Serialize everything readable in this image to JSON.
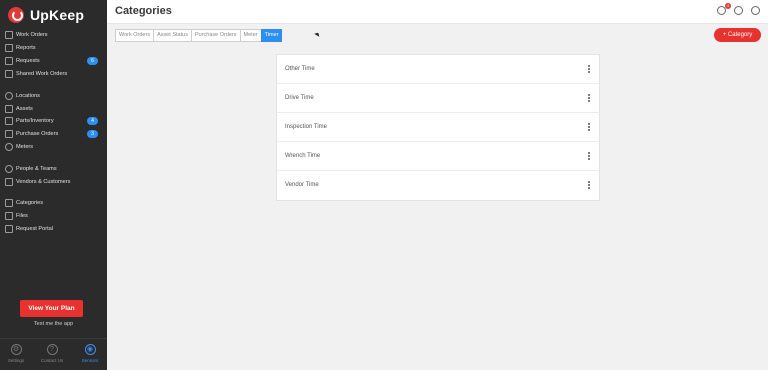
{
  "brand": {
    "name": "UpKeep"
  },
  "sidebar": {
    "items": [
      {
        "label": "Work Orders",
        "icon": "clipboard-icon"
      },
      {
        "label": "Reports",
        "icon": "report-icon"
      },
      {
        "label": "Requests",
        "icon": "inbox-icon",
        "badge": "6"
      },
      {
        "label": "Shared Work Orders",
        "icon": "share-icon"
      },
      {
        "label": "Locations",
        "icon": "location-icon"
      },
      {
        "label": "Assets",
        "icon": "asset-icon"
      },
      {
        "label": "Parts/Inventory",
        "icon": "wrench-icon",
        "badge": "4"
      },
      {
        "label": "Purchase Orders",
        "icon": "cart-icon",
        "badge": "3"
      },
      {
        "label": "Meters",
        "icon": "meter-icon"
      },
      {
        "label": "People & Teams",
        "icon": "people-icon"
      },
      {
        "label": "Vendors & Customers",
        "icon": "vendor-icon"
      },
      {
        "label": "Categories",
        "icon": "tag-icon"
      },
      {
        "label": "Files",
        "icon": "file-icon"
      },
      {
        "label": "Request Portal",
        "icon": "portal-icon"
      }
    ],
    "plan_button": "View Your Plan",
    "text_app": "Text me the app",
    "bottom": [
      {
        "label": "Settings",
        "icon": "gear-icon"
      },
      {
        "label": "Contact Us",
        "icon": "help-icon"
      },
      {
        "label": "Sensors",
        "icon": "sensor-icon"
      }
    ]
  },
  "header": {
    "title": "Categories",
    "notification_count": "4"
  },
  "tabs": [
    {
      "label": "Work Orders",
      "active": false
    },
    {
      "label": "Asset Status",
      "active": false
    },
    {
      "label": "Purchase Orders",
      "active": false
    },
    {
      "label": "Meter",
      "active": false
    },
    {
      "label": "Timer",
      "active": true
    }
  ],
  "add_button": "+ Category",
  "categories": [
    "Other Time",
    "Drive Time",
    "Inspection Time",
    "Wrench Time",
    "Vendor Time"
  ],
  "colors": {
    "accent_red": "#e8322f",
    "accent_blue": "#2d8ff0",
    "sidebar_bg": "#2b2b2b"
  }
}
